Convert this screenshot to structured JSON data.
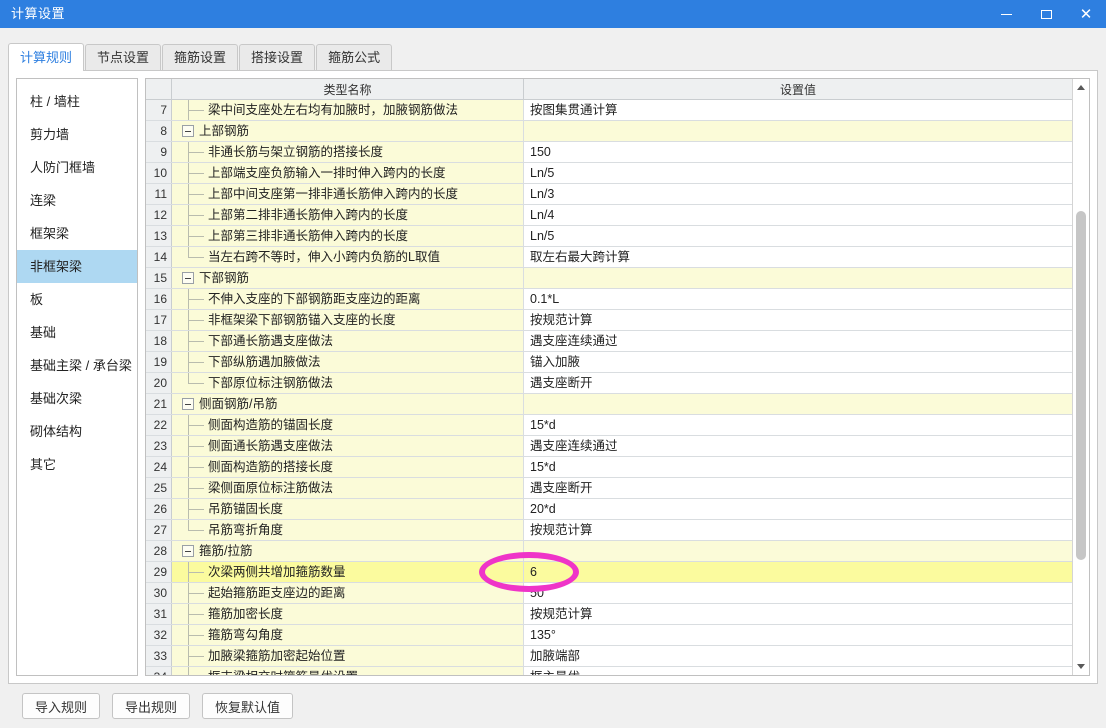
{
  "window": {
    "title": "计算设置",
    "minimize_label": "最小化",
    "maximize_label": "最大化",
    "close_label": "关闭",
    "titlebar_color": "#2e7fe0"
  },
  "tabs": [
    {
      "label": "计算规则",
      "active": true
    },
    {
      "label": "节点设置",
      "active": false
    },
    {
      "label": "箍筋设置",
      "active": false
    },
    {
      "label": "搭接设置",
      "active": false
    },
    {
      "label": "箍筋公式",
      "active": false
    }
  ],
  "sidebar": {
    "selected": "非框架梁",
    "selected_color": "#aed8f2",
    "items": [
      {
        "label": "柱 / 墙柱"
      },
      {
        "label": "剪力墙"
      },
      {
        "label": "人防门框墙"
      },
      {
        "label": "连梁"
      },
      {
        "label": "框架梁"
      },
      {
        "label": "非框架梁"
      },
      {
        "label": "板"
      },
      {
        "label": "基础"
      },
      {
        "label": "基础主梁 / 承台梁"
      },
      {
        "label": "基础次梁"
      },
      {
        "label": "砌体结构"
      },
      {
        "label": "其它"
      }
    ]
  },
  "grid": {
    "columns": {
      "index": "",
      "name": "类型名称",
      "value": "设置值"
    },
    "highlight_color": "#fbfb9e",
    "rows": [
      {
        "num": "7",
        "name": "梁中间支座处左右均有加腋时，加腋钢筋做法",
        "value": "按图集贯通计算",
        "kind": "leaf"
      },
      {
        "num": "8",
        "name": "上部钢筋",
        "value": "",
        "kind": "group"
      },
      {
        "num": "9",
        "name": "非通长筋与架立钢筋的搭接长度",
        "value": "150",
        "kind": "leaf"
      },
      {
        "num": "10",
        "name": "上部端支座负筋输入一排时伸入跨内的长度",
        "value": "Ln/5",
        "kind": "leaf"
      },
      {
        "num": "11",
        "name": "上部中间支座第一排非通长筋伸入跨内的长度",
        "value": "Ln/3",
        "kind": "leaf"
      },
      {
        "num": "12",
        "name": "上部第二排非通长筋伸入跨内的长度",
        "value": "Ln/4",
        "kind": "leaf"
      },
      {
        "num": "13",
        "name": "上部第三排非通长筋伸入跨内的长度",
        "value": "Ln/5",
        "kind": "leaf"
      },
      {
        "num": "14",
        "name": "当左右跨不等时，伸入小跨内负筋的L取值",
        "value": "取左右最大跨计算",
        "kind": "last"
      },
      {
        "num": "15",
        "name": "下部钢筋",
        "value": "",
        "kind": "group"
      },
      {
        "num": "16",
        "name": "不伸入支座的下部钢筋距支座边的距离",
        "value": "0.1*L",
        "kind": "leaf"
      },
      {
        "num": "17",
        "name": "非框架梁下部钢筋锚入支座的长度",
        "value": "按规范计算",
        "kind": "leaf"
      },
      {
        "num": "18",
        "name": "下部通长筋遇支座做法",
        "value": "遇支座连续通过",
        "kind": "leaf"
      },
      {
        "num": "19",
        "name": "下部纵筋遇加腋做法",
        "value": "锚入加腋",
        "kind": "leaf"
      },
      {
        "num": "20",
        "name": "下部原位标注钢筋做法",
        "value": "遇支座断开",
        "kind": "last"
      },
      {
        "num": "21",
        "name": "侧面钢筋/吊筋",
        "value": "",
        "kind": "group"
      },
      {
        "num": "22",
        "name": "侧面构造筋的锚固长度",
        "value": "15*d",
        "kind": "leaf"
      },
      {
        "num": "23",
        "name": "侧面通长筋遇支座做法",
        "value": "遇支座连续通过",
        "kind": "leaf"
      },
      {
        "num": "24",
        "name": "侧面构造筋的搭接长度",
        "value": "15*d",
        "kind": "leaf"
      },
      {
        "num": "25",
        "name": "梁侧面原位标注筋做法",
        "value": "遇支座断开",
        "kind": "leaf"
      },
      {
        "num": "26",
        "name": "吊筋锚固长度",
        "value": "20*d",
        "kind": "leaf"
      },
      {
        "num": "27",
        "name": "吊筋弯折角度",
        "value": "按规范计算",
        "kind": "last"
      },
      {
        "num": "28",
        "name": "箍筋/拉筋",
        "value": "",
        "kind": "group"
      },
      {
        "num": "29",
        "name": "次梁两侧共增加箍筋数量",
        "value": "6",
        "kind": "leaf",
        "highlight": true
      },
      {
        "num": "30",
        "name": "起始箍筋距支座边的距离",
        "value": "50",
        "kind": "leaf"
      },
      {
        "num": "31",
        "name": "箍筋加密长度",
        "value": "按规范计算",
        "kind": "leaf"
      },
      {
        "num": "32",
        "name": "箍筋弯勾角度",
        "value": "135°",
        "kind": "leaf"
      },
      {
        "num": "33",
        "name": "加腋梁箍筋加密起始位置",
        "value": "加腋端部",
        "kind": "leaf"
      },
      {
        "num": "34",
        "name": "框支梁相交时箍筋最优设置",
        "value": "框主最优",
        "kind": "leaf"
      }
    ]
  },
  "scrollbar": {
    "up_arrow": "scroll-up-icon",
    "down_arrow": "scroll-down-icon"
  },
  "annotation": {
    "shape": "ellipse",
    "color": "#ef34c8",
    "target_value": "6"
  },
  "footer": {
    "buttons": [
      {
        "label": "导入规则"
      },
      {
        "label": "导出规则"
      },
      {
        "label": "恢复默认值"
      }
    ]
  }
}
